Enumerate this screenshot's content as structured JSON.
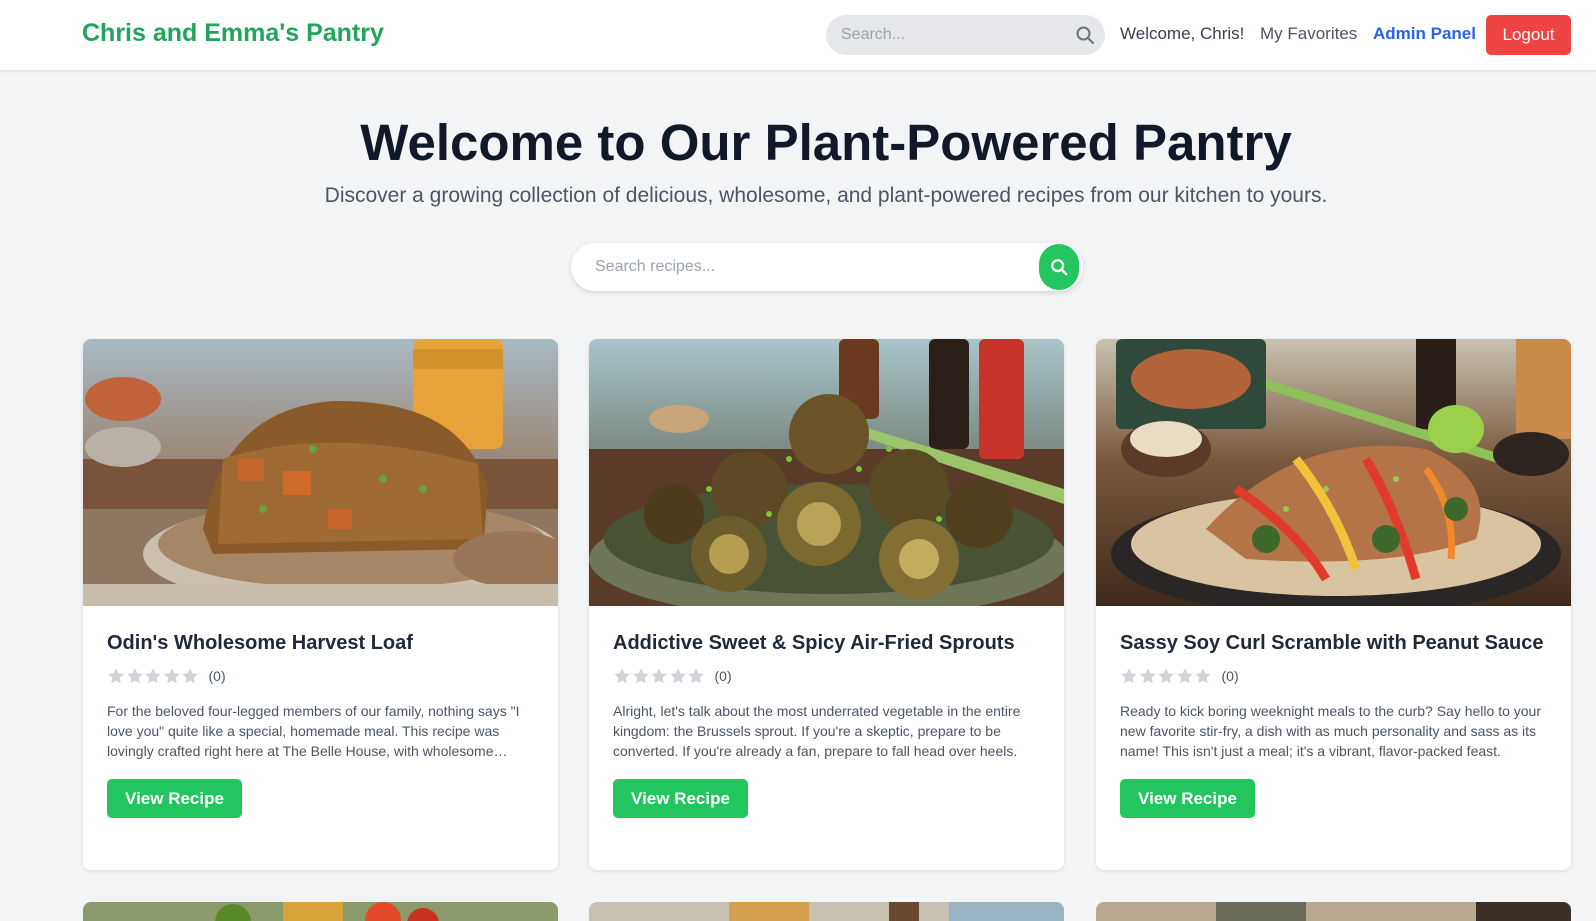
{
  "header": {
    "brand": "Chris and Emma's Pantry",
    "search_placeholder": "Search...",
    "welcome": "Welcome, Chris!",
    "favorites": "My Favorites",
    "admin": "Admin Panel",
    "logout": "Logout"
  },
  "hero": {
    "title": "Welcome to Our Plant-Powered Pantry",
    "subtitle": "Discover a growing collection of delicious, wholesome, and plant-powered recipes from our kitchen to yours.",
    "search_placeholder": "Search recipes..."
  },
  "recipes": [
    {
      "title": "Odin's Wholesome Harvest Loaf",
      "rating_count": "(0)",
      "rating": 0,
      "description": "For the beloved four-legged members of our family, nothing says \"I love you\" quite like a special, homemade meal. This recipe was lovingly crafted right here at The Belle House, with wholesome ingredients.",
      "button": "View Recipe",
      "image_icon": "harvest-loaf-photo"
    },
    {
      "title": "Addictive Sweet & Spicy Air-Fried Sprouts",
      "rating_count": "(0)",
      "rating": 0,
      "description": "Alright, let's talk about the most underrated vegetable in the entire kingdom: the Brussels sprout. If you're a skeptic, prepare to be converted. If you're already a fan, prepare to fall head over heels.",
      "button": "View Recipe",
      "image_icon": "brussels-sprouts-photo"
    },
    {
      "title": "Sassy Soy Curl Scramble with Peanut Sauce",
      "rating_count": "(0)",
      "rating": 0,
      "description": "Ready to kick boring weeknight meals to the curb? Say hello to your new favorite stir-fry, a dish with as much personality and sass as its name! This isn't just a meal; it's a vibrant, flavor-packed feast.",
      "button": "View Recipe",
      "image_icon": "soy-curl-stirfry-photo"
    }
  ],
  "colors": {
    "brand": "#22a55a",
    "primary_button": "#22c55e",
    "logout": "#ef4444",
    "admin_link": "#2563eb",
    "background": "#f3f4f6"
  }
}
